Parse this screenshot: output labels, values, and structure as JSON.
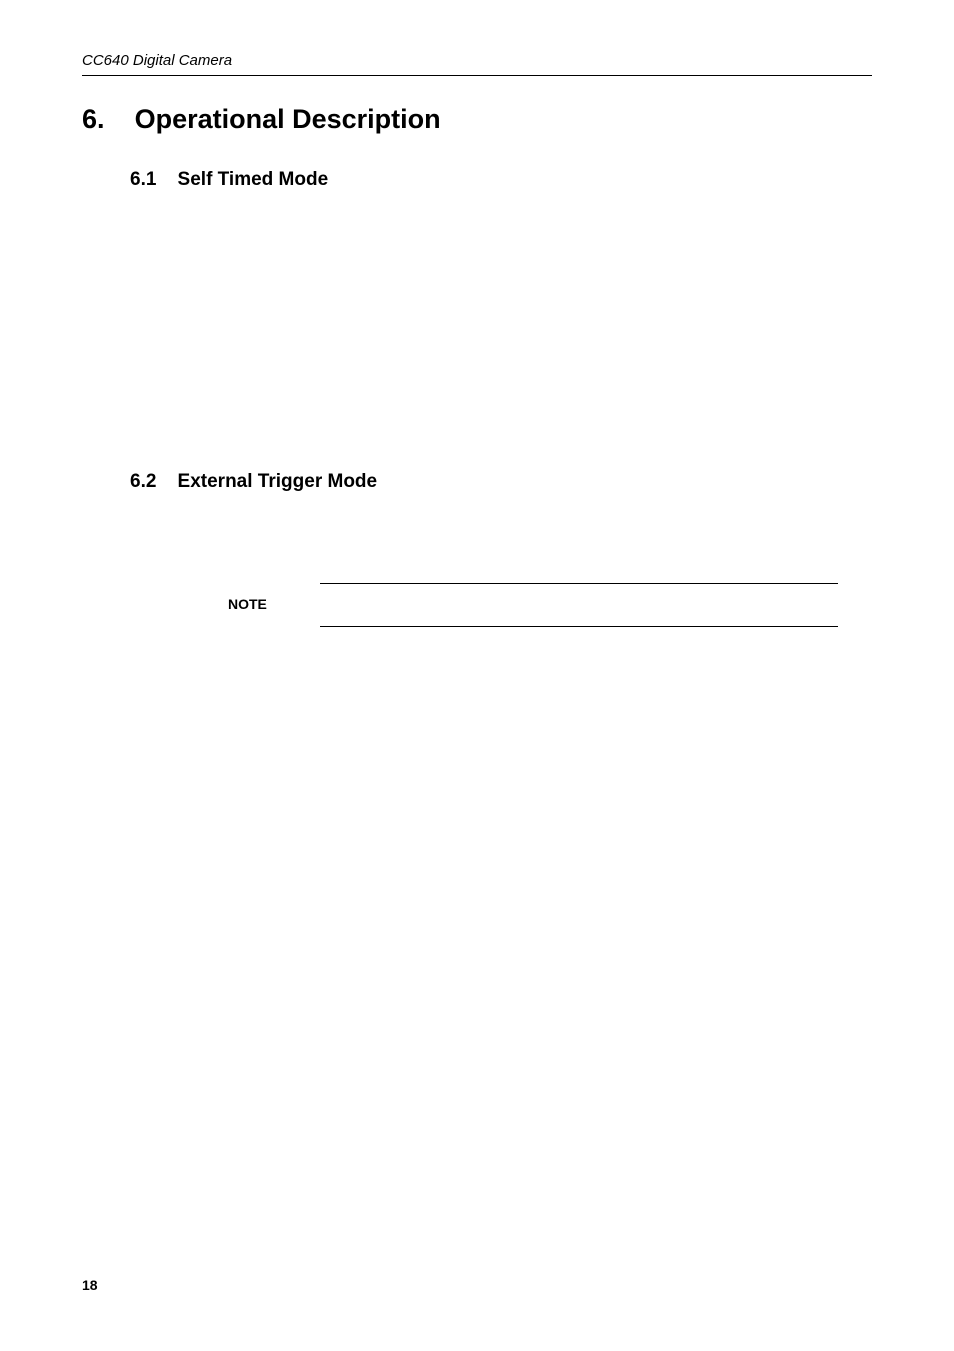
{
  "header": {
    "running": "CC640 Digital Camera"
  },
  "sections": {
    "s6": {
      "number": "6.",
      "title": "Operational Description",
      "sub1": {
        "number": "6.1",
        "title": "Self Timed Mode"
      },
      "sub2": {
        "number": "6.2",
        "title": "External Trigger Mode"
      }
    }
  },
  "note": {
    "label": "NOTE"
  },
  "footer": {
    "page": "18"
  }
}
